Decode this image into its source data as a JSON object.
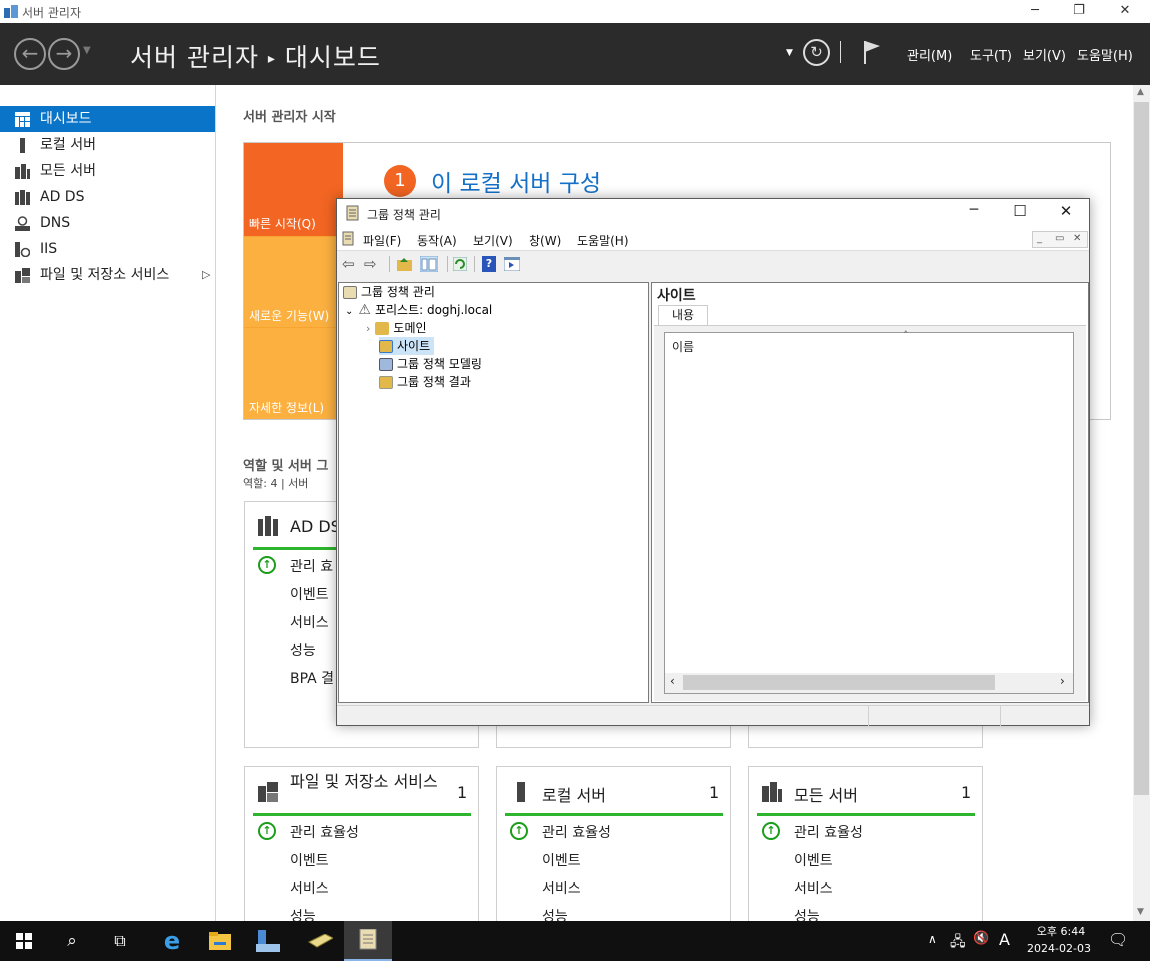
{
  "window": {
    "title": "서버 관리자"
  },
  "header": {
    "title": "서버 관리자",
    "separator": "▸",
    "page": "대시보드",
    "menu": [
      "관리(M)",
      "도구(T)",
      "보기(V)",
      "도움말(H)"
    ]
  },
  "sidebar": {
    "items": [
      {
        "label": "대시보드",
        "icon": "dashboard-icon",
        "selected": true
      },
      {
        "label": "로컬 서버",
        "icon": "server-icon"
      },
      {
        "label": "모든 서버",
        "icon": "servers-icon"
      },
      {
        "label": "AD DS",
        "icon": "ad-ds-icon"
      },
      {
        "label": "DNS",
        "icon": "dns-icon"
      },
      {
        "label": "IIS",
        "icon": "iis-icon"
      },
      {
        "label": "파일 및 저장소 서비스",
        "icon": "file-storage-icon",
        "arrow": "▷"
      }
    ]
  },
  "welcome": {
    "heading": "서버 관리자 시작",
    "step_num": "1",
    "step_label": "이 로컬 서버 구성",
    "tabs": [
      "빠른 시작(Q)",
      "새로운 기능(W)",
      "자세한 정보(L)"
    ]
  },
  "roles": {
    "heading": "역할 및 서버 그",
    "subtitle": "역할: 4 | 서버"
  },
  "tiles": [
    {
      "title": "AD DS",
      "count": "",
      "rows": [
        "관리 효",
        "이벤트",
        "서비스",
        "성능",
        "BPA 결"
      ]
    },
    {
      "title": "파일 및 저장소 서비스",
      "count": "1",
      "rows": [
        "관리 효율성",
        "이벤트",
        "서비스",
        "성능"
      ]
    },
    {
      "title": "로컬 서버",
      "count": "1",
      "rows": [
        "관리 효율성",
        "이벤트",
        "서비스",
        "성능"
      ]
    },
    {
      "title": "모든 서버",
      "count": "1",
      "rows": [
        "관리 효율성",
        "이벤트",
        "서비스",
        "성능"
      ]
    }
  ],
  "gpm": {
    "title": "그룹 정책 관리",
    "menu": [
      "파일(F)",
      "동작(A)",
      "보기(V)",
      "창(W)",
      "도움말(H)"
    ],
    "tree": {
      "root": "그룹 정책 관리",
      "forest": "포리스트: doghj.local",
      "children": [
        "도메인",
        "사이트",
        "그룹 정책 모델링",
        "그룹 정책 결과"
      ],
      "selected": "사이트"
    },
    "right": {
      "heading": "사이트",
      "tab": "내용",
      "column": "이름"
    }
  },
  "taskbar": {
    "time": "오후 6:44",
    "date": "2024-02-03",
    "ime": "A"
  },
  "colors": {
    "header_bg": "#2b2b2b",
    "accent": "#0a74c8",
    "orange_dark": "#f26522",
    "orange_light": "#fbb040",
    "green": "#2db52d"
  }
}
